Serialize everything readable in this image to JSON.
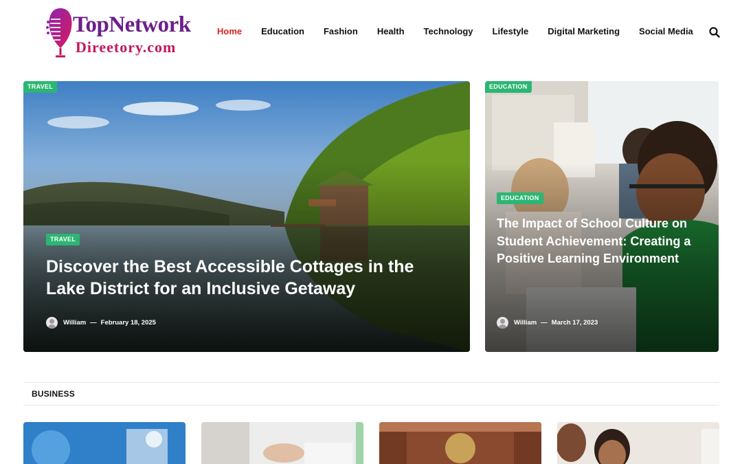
{
  "logo": {
    "top_text": "TopNetwork",
    "bottom_text": "Direetory.com"
  },
  "nav": {
    "items": [
      "Home",
      "Education",
      "Fashion",
      "Health",
      "Technology",
      "Lifestyle",
      "Digital Marketing",
      "Social Media"
    ],
    "active": "Home"
  },
  "hero_main": {
    "corner_badge": "TRAVEL",
    "badge": "TRAVEL",
    "title": "Discover the Best Accessible Cottages in the Lake District for an Inclusive Getaway",
    "author": "William",
    "separator": "—",
    "date": "February 18, 2025"
  },
  "hero_side": {
    "corner_badge": "EDUCATION",
    "badge": "EDUCATION",
    "title": "The Impact of School Culture on Student Achievement: Creating a Positive Learning Environment",
    "author": "William",
    "separator": "—",
    "date": "March 17, 2023"
  },
  "section": {
    "title": "BUSINESS"
  },
  "colors": {
    "accent_red": "#d7261e",
    "badge_green": "#2bb673",
    "logo_purple": "#6c1f8c",
    "logo_pink": "#c2185b"
  },
  "icons": {
    "search": "search-icon",
    "logo": "microphone-logo-icon",
    "avatar": "avatar-icon"
  }
}
